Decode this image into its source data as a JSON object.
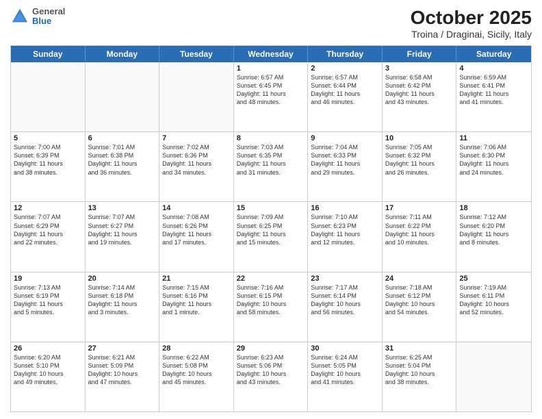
{
  "header": {
    "logo": {
      "general": "General",
      "blue": "Blue"
    },
    "title": "October 2025",
    "subtitle": "Troina / Draginai, Sicily, Italy"
  },
  "days_of_week": [
    "Sunday",
    "Monday",
    "Tuesday",
    "Wednesday",
    "Thursday",
    "Friday",
    "Saturday"
  ],
  "weeks": [
    [
      {
        "day": "",
        "text": "",
        "empty": true
      },
      {
        "day": "",
        "text": "",
        "empty": true
      },
      {
        "day": "",
        "text": "",
        "empty": true
      },
      {
        "day": "1",
        "text": "Sunrise: 6:57 AM\nSunset: 6:45 PM\nDaylight: 11 hours\nand 48 minutes."
      },
      {
        "day": "2",
        "text": "Sunrise: 6:57 AM\nSunset: 6:44 PM\nDaylight: 11 hours\nand 46 minutes."
      },
      {
        "day": "3",
        "text": "Sunrise: 6:58 AM\nSunset: 6:42 PM\nDaylight: 11 hours\nand 43 minutes."
      },
      {
        "day": "4",
        "text": "Sunrise: 6:59 AM\nSunset: 6:41 PM\nDaylight: 11 hours\nand 41 minutes."
      }
    ],
    [
      {
        "day": "5",
        "text": "Sunrise: 7:00 AM\nSunset: 6:39 PM\nDaylight: 11 hours\nand 38 minutes."
      },
      {
        "day": "6",
        "text": "Sunrise: 7:01 AM\nSunset: 6:38 PM\nDaylight: 11 hours\nand 36 minutes."
      },
      {
        "day": "7",
        "text": "Sunrise: 7:02 AM\nSunset: 6:36 PM\nDaylight: 11 hours\nand 34 minutes."
      },
      {
        "day": "8",
        "text": "Sunrise: 7:03 AM\nSunset: 6:35 PM\nDaylight: 11 hours\nand 31 minutes."
      },
      {
        "day": "9",
        "text": "Sunrise: 7:04 AM\nSunset: 6:33 PM\nDaylight: 11 hours\nand 29 minutes."
      },
      {
        "day": "10",
        "text": "Sunrise: 7:05 AM\nSunset: 6:32 PM\nDaylight: 11 hours\nand 26 minutes."
      },
      {
        "day": "11",
        "text": "Sunrise: 7:06 AM\nSunset: 6:30 PM\nDaylight: 11 hours\nand 24 minutes."
      }
    ],
    [
      {
        "day": "12",
        "text": "Sunrise: 7:07 AM\nSunset: 6:29 PM\nDaylight: 11 hours\nand 22 minutes."
      },
      {
        "day": "13",
        "text": "Sunrise: 7:07 AM\nSunset: 6:27 PM\nDaylight: 11 hours\nand 19 minutes."
      },
      {
        "day": "14",
        "text": "Sunrise: 7:08 AM\nSunset: 6:26 PM\nDaylight: 11 hours\nand 17 minutes."
      },
      {
        "day": "15",
        "text": "Sunrise: 7:09 AM\nSunset: 6:25 PM\nDaylight: 11 hours\nand 15 minutes."
      },
      {
        "day": "16",
        "text": "Sunrise: 7:10 AM\nSunset: 6:23 PM\nDaylight: 11 hours\nand 12 minutes."
      },
      {
        "day": "17",
        "text": "Sunrise: 7:11 AM\nSunset: 6:22 PM\nDaylight: 11 hours\nand 10 minutes."
      },
      {
        "day": "18",
        "text": "Sunrise: 7:12 AM\nSunset: 6:20 PM\nDaylight: 11 hours\nand 8 minutes."
      }
    ],
    [
      {
        "day": "19",
        "text": "Sunrise: 7:13 AM\nSunset: 6:19 PM\nDaylight: 11 hours\nand 5 minutes."
      },
      {
        "day": "20",
        "text": "Sunrise: 7:14 AM\nSunset: 6:18 PM\nDaylight: 11 hours\nand 3 minutes."
      },
      {
        "day": "21",
        "text": "Sunrise: 7:15 AM\nSunset: 6:16 PM\nDaylight: 11 hours\nand 1 minute."
      },
      {
        "day": "22",
        "text": "Sunrise: 7:16 AM\nSunset: 6:15 PM\nDaylight: 10 hours\nand 58 minutes."
      },
      {
        "day": "23",
        "text": "Sunrise: 7:17 AM\nSunset: 6:14 PM\nDaylight: 10 hours\nand 56 minutes."
      },
      {
        "day": "24",
        "text": "Sunrise: 7:18 AM\nSunset: 6:12 PM\nDaylight: 10 hours\nand 54 minutes."
      },
      {
        "day": "25",
        "text": "Sunrise: 7:19 AM\nSunset: 6:11 PM\nDaylight: 10 hours\nand 52 minutes."
      }
    ],
    [
      {
        "day": "26",
        "text": "Sunrise: 6:20 AM\nSunset: 5:10 PM\nDaylight: 10 hours\nand 49 minutes."
      },
      {
        "day": "27",
        "text": "Sunrise: 6:21 AM\nSunset: 5:09 PM\nDaylight: 10 hours\nand 47 minutes."
      },
      {
        "day": "28",
        "text": "Sunrise: 6:22 AM\nSunset: 5:08 PM\nDaylight: 10 hours\nand 45 minutes."
      },
      {
        "day": "29",
        "text": "Sunrise: 6:23 AM\nSunset: 5:06 PM\nDaylight: 10 hours\nand 43 minutes."
      },
      {
        "day": "30",
        "text": "Sunrise: 6:24 AM\nSunset: 5:05 PM\nDaylight: 10 hours\nand 41 minutes."
      },
      {
        "day": "31",
        "text": "Sunrise: 6:25 AM\nSunset: 5:04 PM\nDaylight: 10 hours\nand 38 minutes."
      },
      {
        "day": "",
        "text": "",
        "empty": true
      }
    ]
  ]
}
